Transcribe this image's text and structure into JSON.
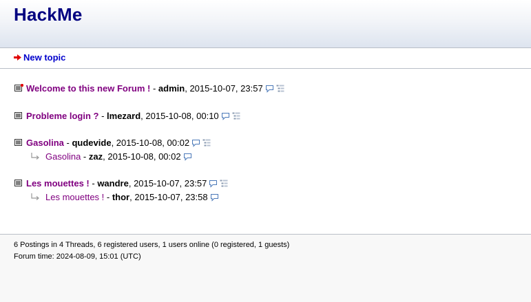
{
  "site": {
    "title": "HackMe"
  },
  "nav": {
    "new_topic_label": "New topic"
  },
  "threads": [
    {
      "subject": "Welcome to this new Forum !",
      "author": "admin",
      "date": "2015-10-07, 23:57",
      "new": true,
      "replies": []
    },
    {
      "subject": "Probleme login ?",
      "author": "lmezard",
      "date": "2015-10-08, 00:10",
      "new": false,
      "replies": []
    },
    {
      "subject": "Gasolina",
      "author": "qudevide",
      "date": "2015-10-08, 00:02",
      "new": false,
      "replies": [
        {
          "subject": "Gasolina",
          "author": "zaz",
          "date": "2015-10-08, 00:02"
        }
      ]
    },
    {
      "subject": "Les mouettes !",
      "author": "wandre",
      "date": "2015-10-07, 23:57",
      "new": false,
      "replies": [
        {
          "subject": "Les mouettes !",
          "author": "thor",
          "date": "2015-10-07, 23:58"
        }
      ]
    }
  ],
  "footer": {
    "stats": "6 Postings in 4 Threads, 6 registered users, 1 users online (0 registered, 1 guests)",
    "forum_time": "Forum time: 2024-08-09, 15:01 (UTC)"
  },
  "colors": {
    "title": "#000080",
    "link": "#0000cc",
    "visited": "#800080",
    "new_marker": "#e00000"
  },
  "icons": {
    "new_topic": "red-arrow-icon",
    "thread": "thread-list-icon",
    "reply": "reply-arrow-icon",
    "bubble": "speech-bubble-icon",
    "tree": "tree-view-icon"
  }
}
